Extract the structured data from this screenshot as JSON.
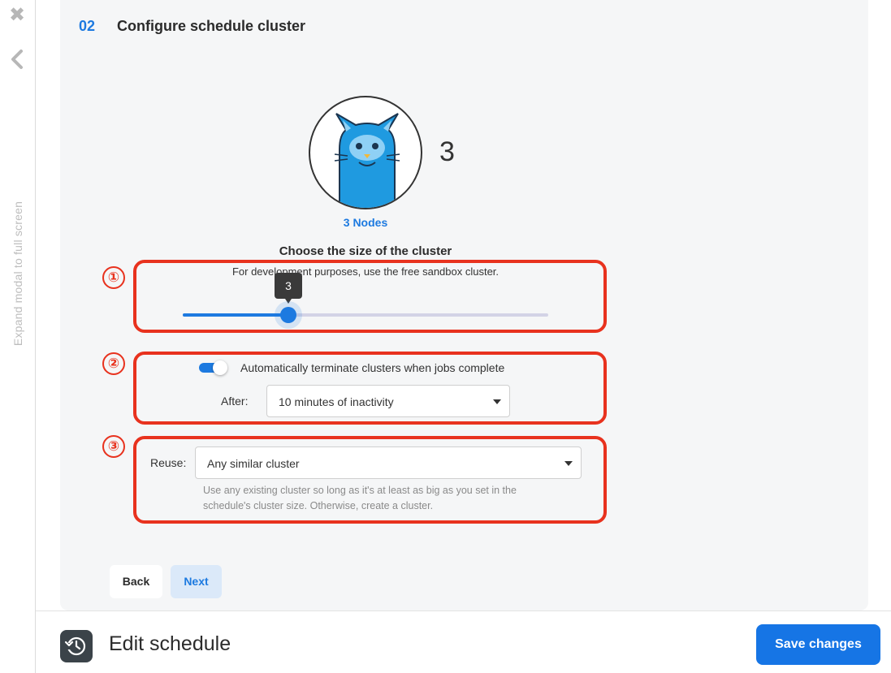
{
  "rail": {
    "close_icon": "close-x-icon",
    "back_icon": "chevron-left-icon",
    "expand_label": "Expand modal to full screen"
  },
  "step": {
    "number": "02",
    "title": "Configure schedule cluster"
  },
  "cluster": {
    "avatar_icon": "cat-mascot-icon",
    "node_count": "3",
    "node_label": "3 Nodes",
    "size_title": "Choose the size of the cluster",
    "size_subtitle": "For development purposes, use the free sandbox cluster.",
    "slider_value": "3",
    "slider_fraction": 0.288
  },
  "annotations": {
    "one": "①",
    "two": "②",
    "three": "③",
    "color": "#e8321e"
  },
  "termination": {
    "toggle_on": true,
    "toggle_label": "Automatically terminate clusters when jobs complete",
    "after_label": "After:",
    "after_value": "10 minutes of inactivity"
  },
  "reuse": {
    "label": "Reuse:",
    "value": "Any similar cluster",
    "help": "Use any existing cluster so long as it's at least as big as you set in the schedule's cluster size. Otherwise, create a cluster."
  },
  "nav": {
    "back_label": "Back",
    "next_label": "Next"
  },
  "footer": {
    "history_icon": "history-icon",
    "title": "Edit schedule",
    "save_label": "Save changes"
  },
  "colors": {
    "accent": "#1d7ae0",
    "save_button": "#1675e5",
    "card_background": "#f5f6f7"
  }
}
